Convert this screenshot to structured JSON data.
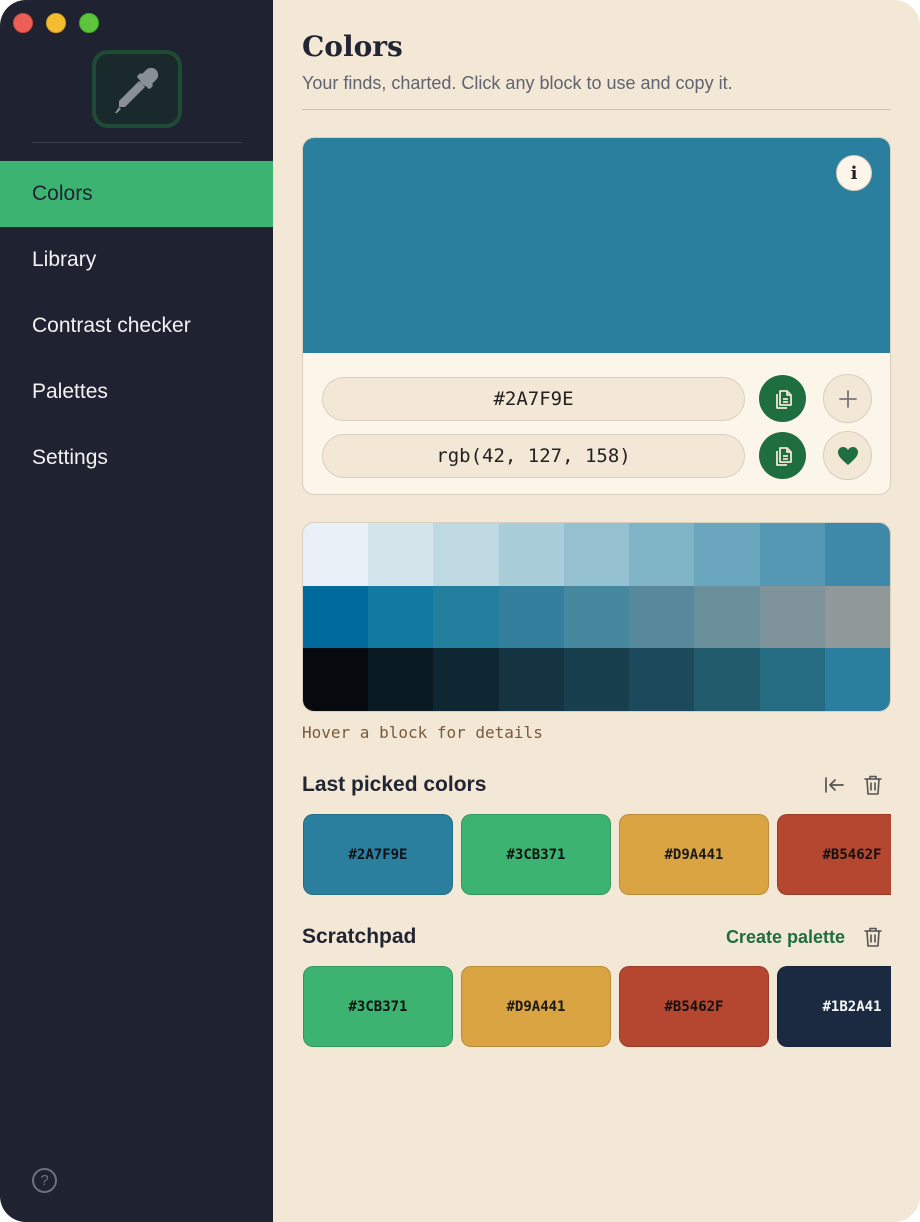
{
  "sidebar": {
    "items": [
      {
        "label": "Colors",
        "active": true
      },
      {
        "label": "Library",
        "active": false
      },
      {
        "label": "Contrast checker",
        "active": false
      },
      {
        "label": "Palettes",
        "active": false
      },
      {
        "label": "Settings",
        "active": false
      }
    ],
    "help_glyph": "?",
    "app_icon": "eyedropper-icon"
  },
  "header": {
    "title": "Colors",
    "subtitle": "Your finds, charted. Click any block to use and copy it."
  },
  "current_color": {
    "hex": "#2A7F9E",
    "rgb": "rgb(42, 127, 158)",
    "info_glyph": "i"
  },
  "shades": {
    "rows": [
      [
        "#E9F0F7",
        "#D4E5EC",
        "#BFD9E3",
        "#A9CDD9",
        "#94C0D0",
        "#7FB4C7",
        "#6AA7BE",
        "#5598B4",
        "#3F8AAB"
      ],
      [
        "#006A9D",
        "#117AA0",
        "#247F9F",
        "#357F9E",
        "#46889D",
        "#58889C",
        "#6A909B",
        "#7E939A",
        "#919899"
      ],
      [
        "#060A0E",
        "#0A1A22",
        "#0F2732",
        "#133440",
        "#183F4E",
        "#1C4A5C",
        "#215B6C",
        "#256B82",
        "#2A7F9E"
      ]
    ],
    "hint": "Hover a block for details"
  },
  "last_picked": {
    "title": "Last picked colors",
    "colors": [
      "#2A7F9E",
      "#3CB371",
      "#D9A441",
      "#B5462F"
    ]
  },
  "scratchpad": {
    "title": "Scratchpad",
    "create_label": "Create palette",
    "colors": [
      "#3CB371",
      "#D9A441",
      "#B5462F",
      "#1B2A41"
    ]
  },
  "colors": {
    "accent": "#3CB371",
    "sidebar_bg": "#1E2231",
    "dark_green": "#1F6E3F",
    "cream": "#F3E7D6"
  }
}
